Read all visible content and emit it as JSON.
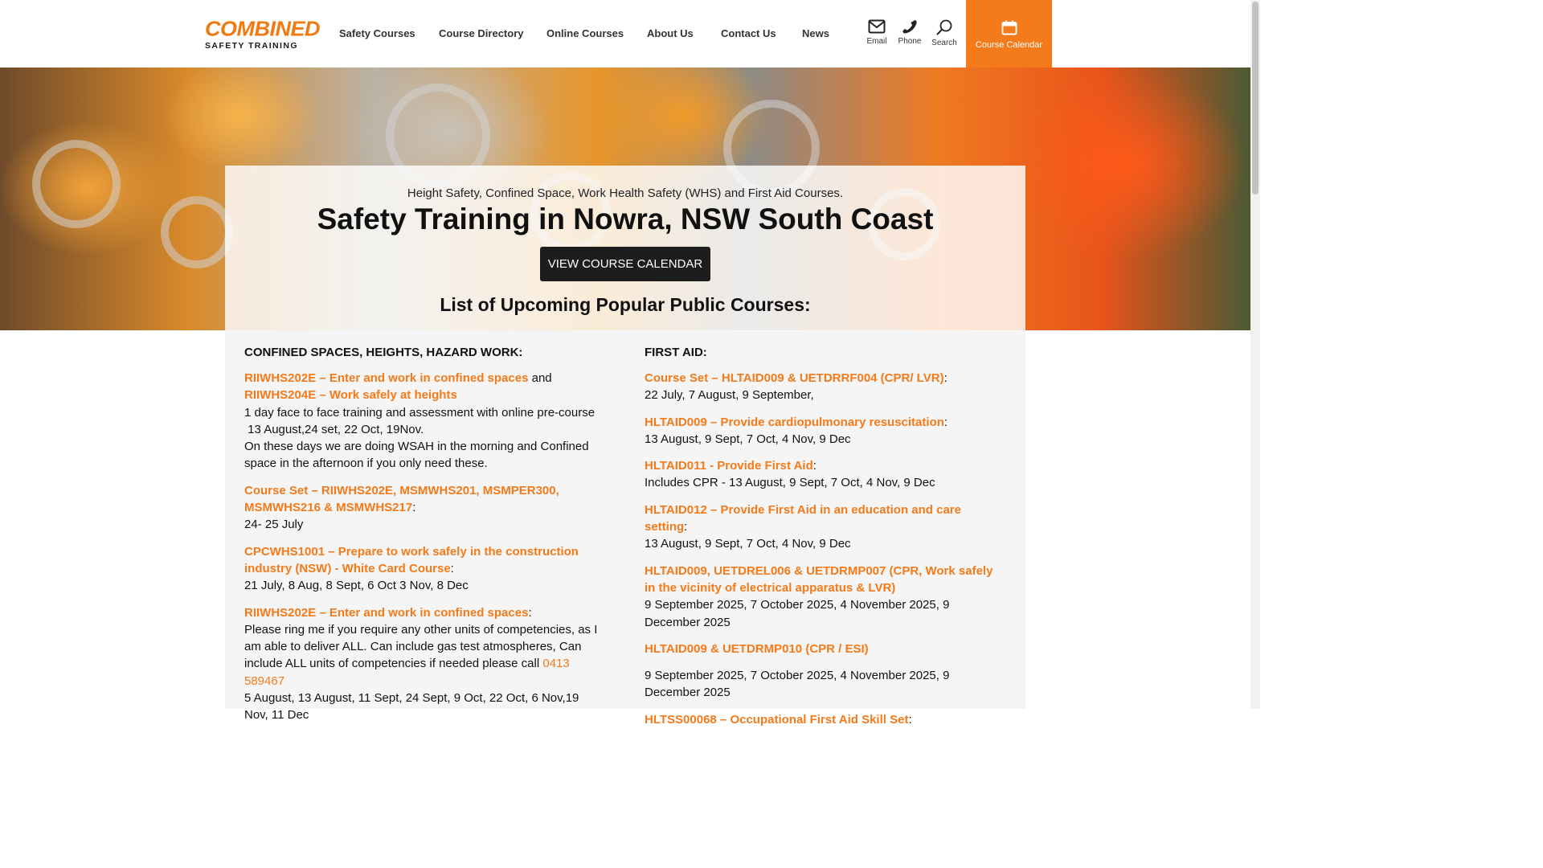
{
  "header": {
    "logo_top": "COMBINED",
    "logo_bottom": "SAFETY TRAINING",
    "nav": [
      "Safety Courses",
      "Course Directory",
      "Online Courses",
      "About Us",
      "Contact Us",
      "News"
    ],
    "tools": {
      "email": "Email",
      "phone": "Phone",
      "search": "Search"
    },
    "calendar_label": "Course Calendar"
  },
  "hero": {
    "subtitle": "Height Safety, Confined Space, Work Health Safety (WHS) and First Aid Courses.",
    "title": "Safety Training in Nowra, NSW South Coast",
    "button": "VIEW COURSE CALENDAR",
    "list_title": "List of Upcoming Popular Public Courses:"
  },
  "left": {
    "heading": "CONFINED SPACES, HEIGHTS, HAZARD WORK:",
    "b1": {
      "link1": "RIIWHS202E – Enter and work in confined spaces",
      "and": " and ",
      "link2": "RIIWHS204E – Work safely at heights",
      "l1": "1 day face to face training and assessment with online pre-course",
      "l2": " 13 August,24 set, 22 Oct, 19Nov.",
      "l3": "On these days we are doing WSAH in the morning and Confined space in the afternoon if you only need these."
    },
    "b2": {
      "link": "Course Set – RIIWHS202E, MSMWHS201, MSMPER300, MSMWHS216 & MSMWHS217",
      "dates": "24- 25 July"
    },
    "b3": {
      "link": "CPCWHS1001 – Prepare to work safely in the construction industry (NSW) - White Card Course",
      "dates": "21 July, 8 Aug, 8 Sept, 6 Oct 3 Nov, 8 Dec"
    },
    "b4": {
      "link": "RIIWHS202E – Enter and work in confined spaces",
      "text": "Please ring me if you require any other units of competencies, as I am able to deliver ALL. Can include gas test atmospheres, Can include ALL units of competencies if needed please call ",
      "phone": "0413 589467",
      "dates": "5 August, 13 August, 11 Sept, 24 Sept, 9  Oct, 22 Oct, 6 Nov,19 Nov, 11 Dec"
    }
  },
  "right": {
    "heading": "FIRST AID:",
    "b1": {
      "link": "Course Set – HLTAID009 & UETDRRF004 (CPR/ LVR)",
      "dates": "22 July, 7 August, 9 September,"
    },
    "b2": {
      "link": "HLTAID009 – Provide cardiopulmonary resuscitation",
      "dates": "13 August, 9 Sept, 7 Oct, 4 Nov, 9 Dec"
    },
    "b3": {
      "link": "HLTAID011 - Provide First Aid",
      "dates": "Includes CPR -  13 August, 9 Sept, 7 Oct, 4 Nov, 9 Dec"
    },
    "b4": {
      "link": "HLTAID012 – Provide First Aid in an education and care setting",
      "dates": "13 August, 9 Sept, 7 Oct, 4 Nov, 9 Dec"
    },
    "b5": {
      "link": "HLTAID009, UETDREL006 & UETDRMP007 (CPR, Work safely in the vicinity of electrical apparatus & LVR)",
      "dates": "9 September 2025, 7 October 2025, 4 November 2025, 9 December 2025"
    },
    "b6": {
      "link": "HLTAID009 & UETDRMP010 (CPR / ESI)",
      "dates": "9 September 2025, 7 October 2025, 4 November 2025, 9 December 2025"
    },
    "b7": {
      "link": "HLTSS00068 – Occupational First Aid Skill Set"
    }
  },
  "colors": {
    "accent": "#f47a1a",
    "dark_button": "#1d1d1d"
  }
}
